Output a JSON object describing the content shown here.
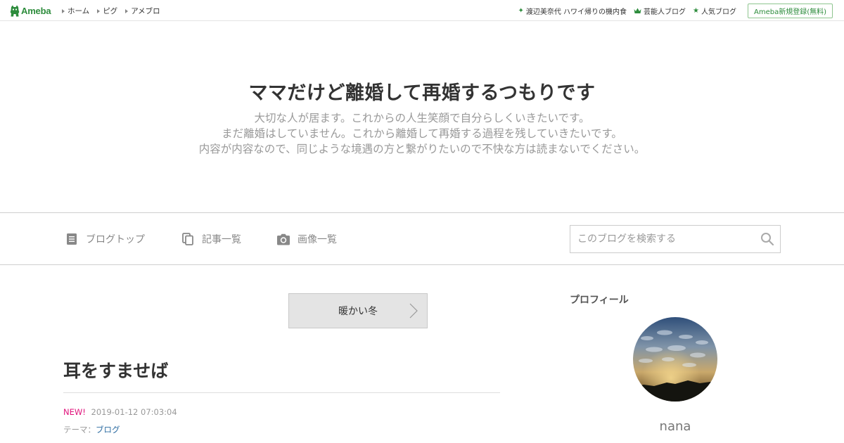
{
  "topbar": {
    "logo_text": "Ameba",
    "nav": [
      "ホーム",
      "ピグ",
      "アメブロ"
    ],
    "right_links": [
      {
        "icon": "sparkle-icon",
        "label": "渡辺美奈代 ハワイ帰りの機内食"
      },
      {
        "icon": "crown-icon",
        "label": "芸能人ブログ"
      },
      {
        "icon": "star-icon",
        "label": "人気ブログ"
      }
    ],
    "signup_label": "Ameba新規登録(無料)"
  },
  "header": {
    "title": "ママだけど離婚して再婚するつもりです",
    "description": [
      "大切な人が居ます。これからの人生笑顔で自分らしくいきたいです。",
      "まだ離婚はしていません。これから離婚して再婚する過程を残していきたいです。",
      "内容が内容なので、同じような境遇の方と繋がりたいので不快な方は読まないでください。"
    ]
  },
  "menu": {
    "items": [
      {
        "icon": "document-icon",
        "label": "ブログトップ"
      },
      {
        "icon": "copy-icon",
        "label": "記事一覧"
      },
      {
        "icon": "camera-icon",
        "label": "画像一覧"
      }
    ],
    "search_placeholder": "このブログを検索する"
  },
  "main": {
    "prev_entry_label": "暖かい冬",
    "entry": {
      "title": "耳をすませば",
      "new_badge": "NEW!",
      "datetime": "2019-01-12 07:03:04",
      "theme_prefix": "テーマ：",
      "theme_link": "ブログ"
    }
  },
  "sidebar": {
    "heading": "プロフィール",
    "profile_name": "nana"
  },
  "colors": {
    "brand_green": "#2d8c3c",
    "new_badge": "#e0127b",
    "link_blue": "#2a6aa0"
  }
}
